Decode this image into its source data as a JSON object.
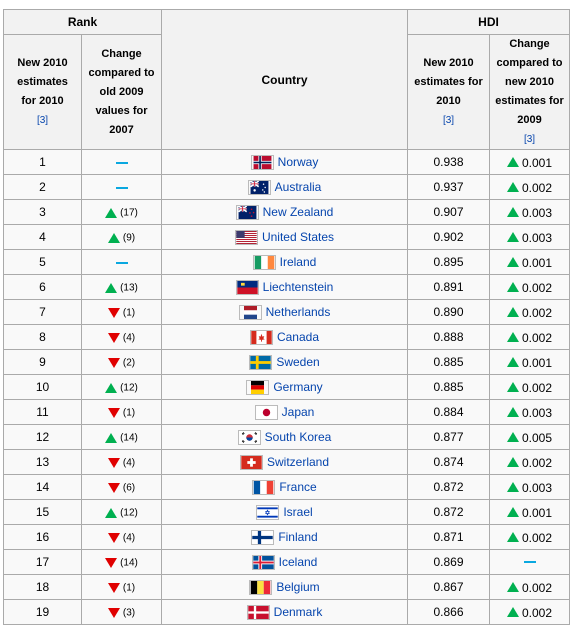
{
  "headers": {
    "rank": "Rank",
    "hdi": "HDI",
    "new_rank": [
      "New 2010",
      "estimates",
      "for 2010"
    ],
    "rank_change": [
      "Change",
      "compared to",
      "old 2009",
      "values for",
      "2007"
    ],
    "country": "Country",
    "new_hdi": [
      "New 2010",
      "estimates for",
      "2010"
    ],
    "hdi_change": [
      "Change",
      "compared to",
      "new 2010",
      "estimates for",
      "2009"
    ],
    "ref": "[3]"
  },
  "colors": {
    "up": "#00b050",
    "down": "#e00000",
    "same": "#0aa8e0",
    "link": "#0645ad"
  },
  "rows": [
    {
      "rank": "1",
      "rank_dir": "same",
      "rank_change": "",
      "country": "Norway",
      "flag": "norway-flag",
      "hdi": "0.938",
      "hdi_dir": "up",
      "hdi_change": "0.001"
    },
    {
      "rank": "2",
      "rank_dir": "same",
      "rank_change": "",
      "country": "Australia",
      "flag": "australia-flag",
      "hdi": "0.937",
      "hdi_dir": "up",
      "hdi_change": "0.002"
    },
    {
      "rank": "3",
      "rank_dir": "up",
      "rank_change": "(17)",
      "country": "New Zealand",
      "flag": "new-zealand-flag",
      "hdi": "0.907",
      "hdi_dir": "up",
      "hdi_change": "0.003"
    },
    {
      "rank": "4",
      "rank_dir": "up",
      "rank_change": "(9)",
      "country": "United States",
      "flag": "united-states-flag",
      "hdi": "0.902",
      "hdi_dir": "up",
      "hdi_change": "0.003"
    },
    {
      "rank": "5",
      "rank_dir": "same",
      "rank_change": "",
      "country": "Ireland",
      "flag": "ireland-flag",
      "hdi": "0.895",
      "hdi_dir": "up",
      "hdi_change": "0.001"
    },
    {
      "rank": "6",
      "rank_dir": "up",
      "rank_change": "(13)",
      "country": "Liechtenstein",
      "flag": "liechtenstein-flag",
      "hdi": "0.891",
      "hdi_dir": "up",
      "hdi_change": "0.002"
    },
    {
      "rank": "7",
      "rank_dir": "down",
      "rank_change": "(1)",
      "country": "Netherlands",
      "flag": "netherlands-flag",
      "hdi": "0.890",
      "hdi_dir": "up",
      "hdi_change": "0.002"
    },
    {
      "rank": "8",
      "rank_dir": "down",
      "rank_change": "(4)",
      "country": "Canada",
      "flag": "canada-flag",
      "hdi": "0.888",
      "hdi_dir": "up",
      "hdi_change": "0.002"
    },
    {
      "rank": "9",
      "rank_dir": "down",
      "rank_change": "(2)",
      "country": "Sweden",
      "flag": "sweden-flag",
      "hdi": "0.885",
      "hdi_dir": "up",
      "hdi_change": "0.001"
    },
    {
      "rank": "10",
      "rank_dir": "up",
      "rank_change": "(12)",
      "country": "Germany",
      "flag": "germany-flag",
      "hdi": "0.885",
      "hdi_dir": "up",
      "hdi_change": "0.002"
    },
    {
      "rank": "11",
      "rank_dir": "down",
      "rank_change": "(1)",
      "country": "Japan",
      "flag": "japan-flag",
      "hdi": "0.884",
      "hdi_dir": "up",
      "hdi_change": "0.003"
    },
    {
      "rank": "12",
      "rank_dir": "up",
      "rank_change": "(14)",
      "country": "South Korea",
      "flag": "south-korea-flag",
      "hdi": "0.877",
      "hdi_dir": "up",
      "hdi_change": "0.005"
    },
    {
      "rank": "13",
      "rank_dir": "down",
      "rank_change": "(4)",
      "country": "Switzerland",
      "flag": "switzerland-flag",
      "hdi": "0.874",
      "hdi_dir": "up",
      "hdi_change": "0.002"
    },
    {
      "rank": "14",
      "rank_dir": "down",
      "rank_change": "(6)",
      "country": "France",
      "flag": "france-flag",
      "hdi": "0.872",
      "hdi_dir": "up",
      "hdi_change": "0.003"
    },
    {
      "rank": "15",
      "rank_dir": "up",
      "rank_change": "(12)",
      "country": "Israel",
      "flag": "israel-flag",
      "hdi": "0.872",
      "hdi_dir": "up",
      "hdi_change": "0.001"
    },
    {
      "rank": "16",
      "rank_dir": "down",
      "rank_change": "(4)",
      "country": "Finland",
      "flag": "finland-flag",
      "hdi": "0.871",
      "hdi_dir": "up",
      "hdi_change": "0.002"
    },
    {
      "rank": "17",
      "rank_dir": "down",
      "rank_change": "(14)",
      "country": "Iceland",
      "flag": "iceland-flag",
      "hdi": "0.869",
      "hdi_dir": "same",
      "hdi_change": ""
    },
    {
      "rank": "18",
      "rank_dir": "down",
      "rank_change": "(1)",
      "country": "Belgium",
      "flag": "belgium-flag",
      "hdi": "0.867",
      "hdi_dir": "up",
      "hdi_change": "0.002"
    },
    {
      "rank": "19",
      "rank_dir": "down",
      "rank_change": "(3)",
      "country": "Denmark",
      "flag": "denmark-flag",
      "hdi": "0.866",
      "hdi_dir": "up",
      "hdi_change": "0.002"
    }
  ]
}
